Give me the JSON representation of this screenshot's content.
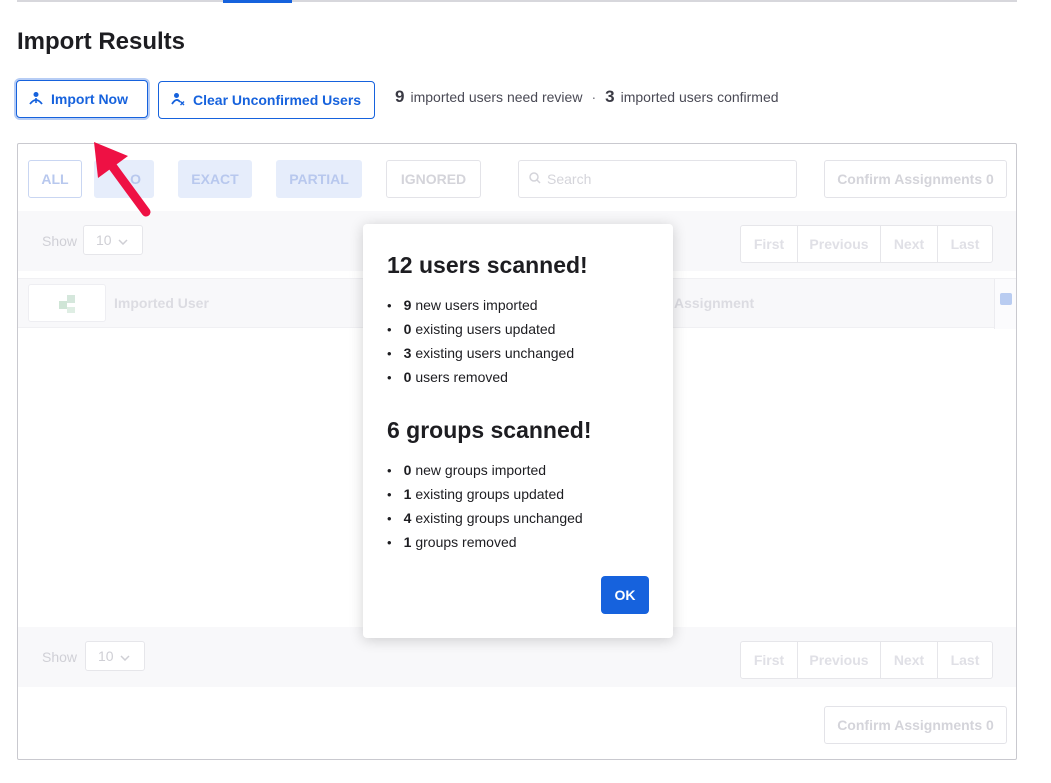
{
  "page_title": "Import Results",
  "toolbar": {
    "import_label": "Import Now",
    "clear_label": "Clear Unconfirmed Users"
  },
  "summary": {
    "review_count": "9",
    "review_text": "imported users need review",
    "confirmed_count": "3",
    "confirmed_text": "imported users confirmed",
    "separator": "·"
  },
  "filters": {
    "all": "ALL",
    "partial_hidden": "O",
    "exact": "EXACT",
    "partial": "PARTIAL",
    "ignored": "IGNORED",
    "search_placeholder": "Search",
    "confirm_label": "Confirm Assignments 0"
  },
  "pagination": {
    "show_label": "Show",
    "page_size": "10",
    "first": "First",
    "previous": "Previous",
    "next": "Next",
    "last": "Last"
  },
  "table": {
    "col_user": "Imported User",
    "col_assignment": "Assignment"
  },
  "modal": {
    "users_title": "12 users scanned!",
    "users_items": [
      {
        "count": "9",
        "text": "new users imported"
      },
      {
        "count": "0",
        "text": "existing users updated"
      },
      {
        "count": "3",
        "text": "existing users unchanged"
      },
      {
        "count": "0",
        "text": "users removed"
      }
    ],
    "groups_title": "6 groups scanned!",
    "groups_items": [
      {
        "count": "0",
        "text": "new groups imported"
      },
      {
        "count": "1",
        "text": "existing groups updated"
      },
      {
        "count": "4",
        "text": "existing groups unchanged"
      },
      {
        "count": "1",
        "text": "groups removed"
      }
    ],
    "ok_label": "OK"
  },
  "colors": {
    "accent": "#1662dd",
    "annotation_arrow": "#ee1144"
  },
  "icons": {
    "import": "user-import-icon",
    "clear": "user-remove-icon",
    "search": "search-icon",
    "chevron": "chevron-down-icon"
  }
}
